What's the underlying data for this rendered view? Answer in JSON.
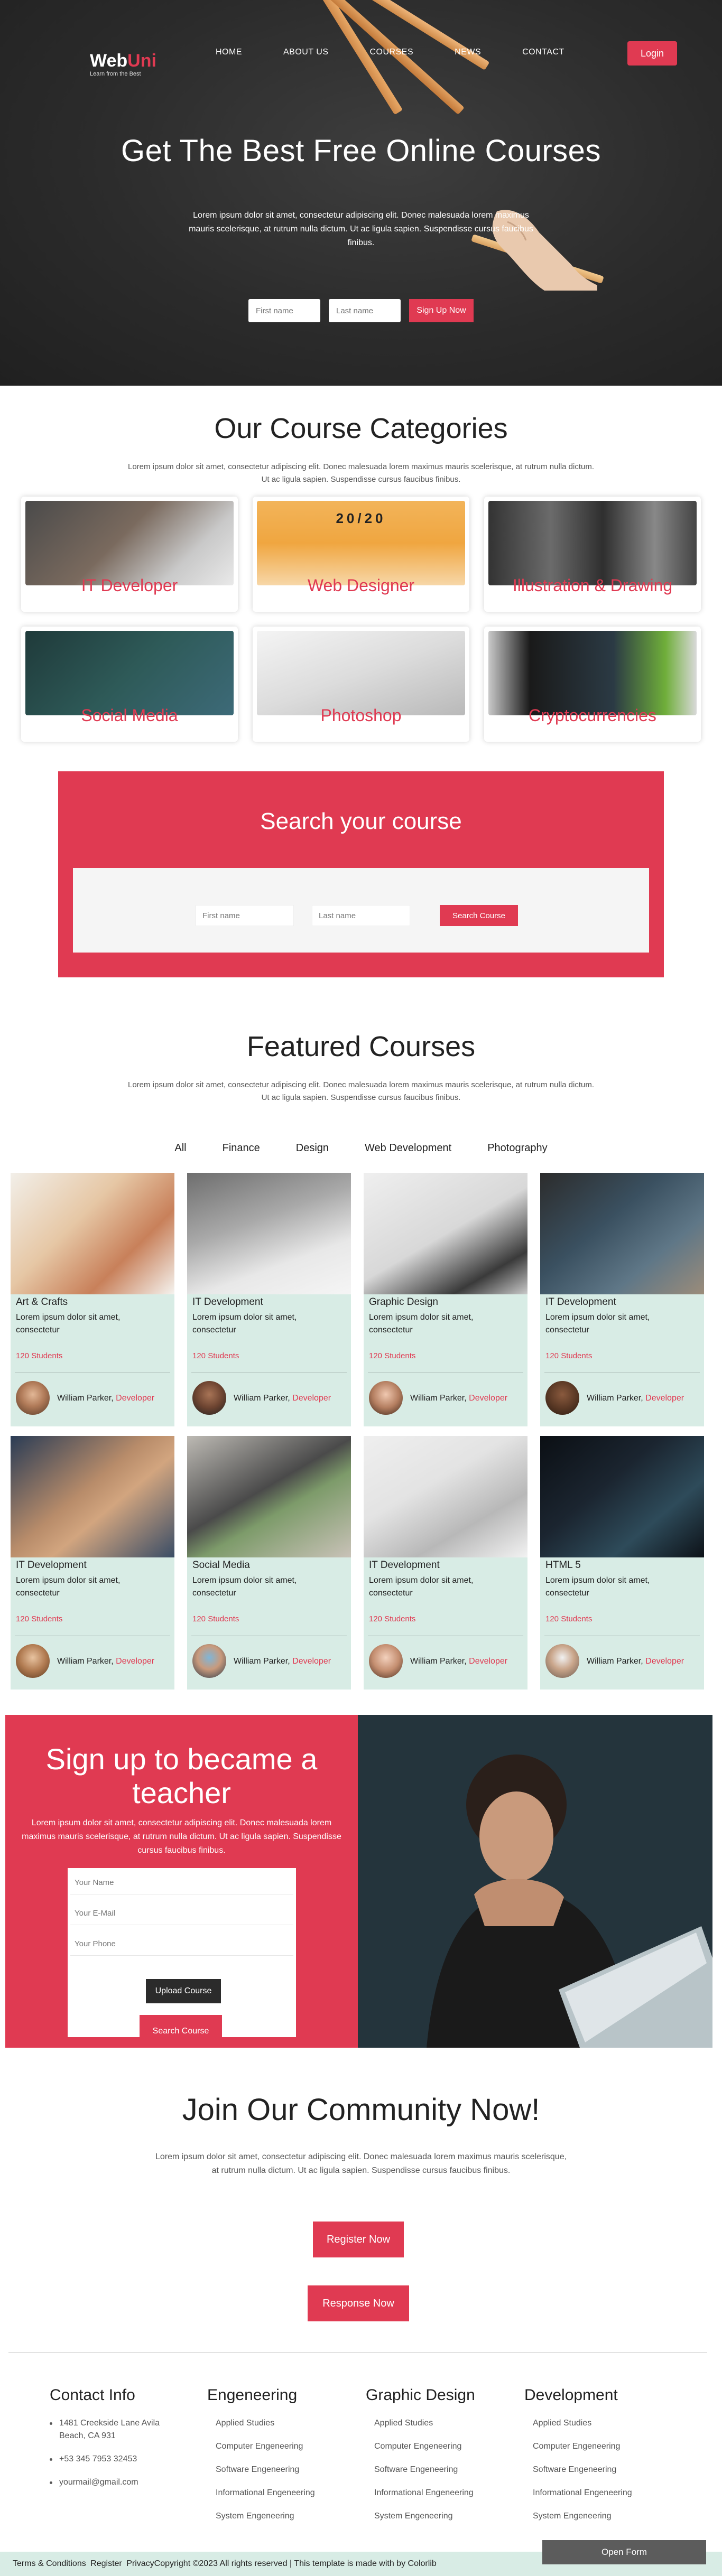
{
  "header": {
    "logo_main": "Web",
    "logo_accent": "Uni",
    "tagline": "Learn from the Best",
    "menu": [
      "HOME",
      "ABOUT US",
      "COURSES",
      "NEWS",
      "CONTACT"
    ],
    "login_label": "Login"
  },
  "hero": {
    "title": "Get The Best Free Online Courses",
    "text": "Lorem ipsum dolor sit amet, consectetur adipiscing elit. Donec malesuada lorem maximus mauris scelerisque, at rutrum nulla dictum. Ut ac ligula sapien. Suspendisse cursus faucibus finibus.",
    "first_name_placeholder": "First name",
    "last_name_placeholder": "Last name",
    "signup_label": "Sign Up Now"
  },
  "categories": {
    "title": "Our Course Categories",
    "desc": "Lorem ipsum dolor sit amet, consectetur adipiscing elit. Donec malesuada lorem maximus mauris scelerisque, at rutrum nulla dictum. Ut ac ligula sapien. Suspendisse cursus faucibus finibus.",
    "items": [
      {
        "label": "IT Developer"
      },
      {
        "label": "Web Designer",
        "img_text": "20/20"
      },
      {
        "label": "Illustration & Drawing"
      },
      {
        "label": "Social Media"
      },
      {
        "label": "Photoshop"
      },
      {
        "label": "Cryptocurrencies"
      }
    ]
  },
  "search": {
    "title": "Search your course",
    "first_name_placeholder": "First name",
    "last_name_placeholder": "Last name",
    "button_label": "Search Course"
  },
  "featured": {
    "title": "Featured Courses",
    "desc": "Lorem ipsum dolor sit amet, consectetur adipiscing elit. Donec malesuada lorem maximus mauris scelerisque, at rutrum nulla dictum. Ut ac ligula sapien. Suspendisse cursus faucibus finibus.",
    "filters": [
      "All",
      "Finance",
      "Design",
      "Web Development",
      "Photography"
    ],
    "courses": [
      {
        "title": "Art & Crafts",
        "desc": "Lorem ipsum dolor sit amet, consectetur",
        "students": "120 Students",
        "author": "William Parker,",
        "role": "Developer"
      },
      {
        "title": "IT Development",
        "desc": "Lorem ipsum dolor sit amet, consectetur",
        "students": "120 Students",
        "author": "William Parker,",
        "role": "Developer"
      },
      {
        "title": "Graphic Design",
        "desc": "Lorem ipsum dolor sit amet, consectetur",
        "students": "120 Students",
        "author": "William Parker,",
        "role": "Developer"
      },
      {
        "title": "IT Development",
        "desc": "Lorem ipsum dolor sit amet, consectetur",
        "students": "120 Students",
        "author": "William Parker,",
        "role": "Developer"
      },
      {
        "title": "IT Development",
        "desc": "Lorem ipsum dolor sit amet, consectetur",
        "students": "120 Students",
        "author": "William Parker,",
        "role": "Developer"
      },
      {
        "title": "Social Media",
        "desc": "Lorem ipsum dolor sit amet, consectetur",
        "students": "120 Students",
        "author": "William Parker,",
        "role": "Developer"
      },
      {
        "title": "IT Development",
        "desc": "Lorem ipsum dolor sit amet, consectetur",
        "students": "120 Students",
        "author": "William Parker,",
        "role": "Developer"
      },
      {
        "title": "HTML 5",
        "desc": "Lorem ipsum dolor sit amet, consectetur",
        "students": "120 Students",
        "author": "William Parker,",
        "role": "Developer"
      }
    ]
  },
  "teacher": {
    "title": "Sign up to became a teacher",
    "text": "Lorem ipsum dolor sit amet, consectetur adipiscing elit. Donec malesuada lorem maximus mauris scelerisque, at rutrum nulla dictum. Ut ac ligula sapien. Suspendisse cursus faucibus finibus.",
    "name_placeholder": "Your Name",
    "email_placeholder": "Your E-Mail",
    "phone_placeholder": "Your Phone",
    "upload_label": "Upload Course",
    "search_label": "Search Course"
  },
  "community": {
    "title": "Join Our Community Now!",
    "desc": "Lorem ipsum dolor sit amet, consectetur adipiscing elit. Donec malesuada lorem maximus mauris scelerisque, at rutrum nulla dictum. Ut ac ligula sapien. Suspendisse cursus faucibus finibus.",
    "register_label": "Register Now",
    "response_label": "Response Now"
  },
  "footer": {
    "contact_title": "Contact Info",
    "contact_items": [
      "1481 Creekside Lane Avila Beach, CA 931",
      "+53 345 7953 32453",
      "yourmail@gmail.com"
    ],
    "columns": [
      {
        "title": "Engeneering",
        "items": [
          "Applied Studies",
          "Computer Engeneering",
          "Software Engeneering",
          "Informational Engeneering",
          "System Engeneering"
        ]
      },
      {
        "title": "Graphic Design",
        "items": [
          "Applied Studies",
          "Computer Engeneering",
          "Software Engeneering",
          "Informational Engeneering",
          "System Engeneering"
        ]
      },
      {
        "title": "Development",
        "items": [
          "Applied Studies",
          "Computer Engeneering",
          "Software Engeneering",
          "Informational Engeneering",
          "System Engeneering"
        ]
      }
    ],
    "bottom_links": [
      "Terms & Conditions",
      "Register",
      "Privacy"
    ],
    "copyright": "Copyright ©2023 All rights reserved | This template is made with by Colorlib",
    "open_form_label": "Open Form"
  },
  "colors": {
    "accent": "#e03a52",
    "mint": "#d8ece5",
    "dark": "#2b2b2b"
  }
}
